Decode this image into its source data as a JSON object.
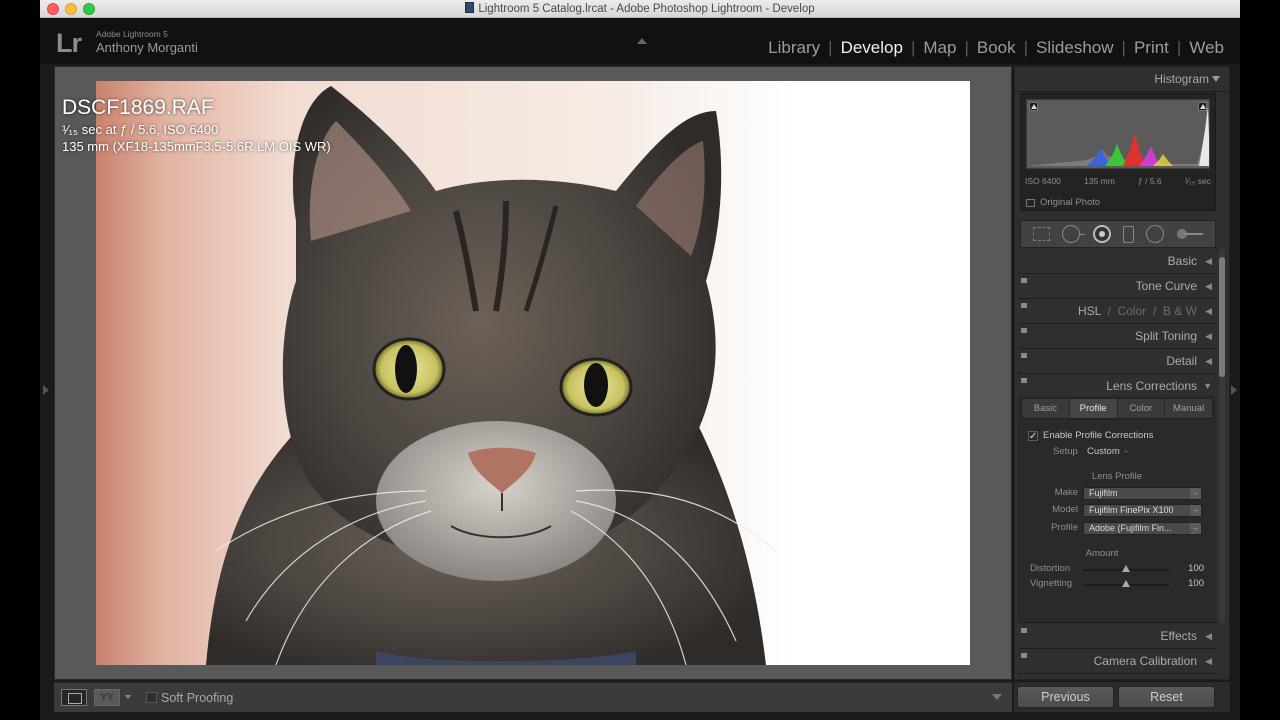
{
  "window": {
    "title": "Lightroom 5 Catalog.lrcat - Adobe Photoshop Lightroom - Develop"
  },
  "identity": {
    "logo": "Lr",
    "app_name": "Adobe Lightroom 5",
    "user": "Anthony Morganti"
  },
  "modules": [
    "Library",
    "Develop",
    "Map",
    "Book",
    "Slideshow",
    "Print",
    "Web"
  ],
  "active_module": "Develop",
  "photo_info": {
    "filename": "DSCF1869.RAF",
    "exposure_line": "¹⁄₁₅ sec at ƒ / 5.6, ISO 6400",
    "lens_line": "135 mm (XF18-135mmF3.5-5.6R LM OIS WR)"
  },
  "toolbar": {
    "compare_label": "YY",
    "soft_proofing": "Soft Proofing"
  },
  "histogram": {
    "title": "Histogram",
    "iso": "ISO 6400",
    "focal": "135 mm",
    "aperture": "ƒ / 5.6",
    "shutter": "¹⁄₁₅ sec",
    "original_photo": "Original Photo"
  },
  "panels": {
    "basic": "Basic",
    "tone_curve": "Tone Curve",
    "hsl": "HSL",
    "color": "Color",
    "bw": "B & W",
    "slash": "/",
    "split_toning": "Split Toning",
    "detail": "Detail",
    "lens_corrections": "Lens Corrections",
    "effects": "Effects",
    "camera_calibration": "Camera Calibration"
  },
  "lens": {
    "tabs": [
      "Basic",
      "Profile",
      "Color",
      "Manual"
    ],
    "active_tab": "Profile",
    "enable_label": "Enable Profile Corrections",
    "enable_checked": true,
    "setup_label": "Setup",
    "setup_value": "Custom",
    "lens_profile_title": "Lens Profile",
    "make_label": "Make",
    "make_value": "Fujifilm",
    "model_label": "Model",
    "model_value": "Fujifilm FinePix X100",
    "profile_label": "Profile",
    "profile_value": "Adobe (Fujifilm Fin...",
    "amount_title": "Amount",
    "distortion_label": "Distortion",
    "distortion_value": "100",
    "vignetting_label": "Vignetting",
    "vignetting_value": "100"
  },
  "buttons": {
    "previous": "Previous",
    "reset": "Reset"
  }
}
